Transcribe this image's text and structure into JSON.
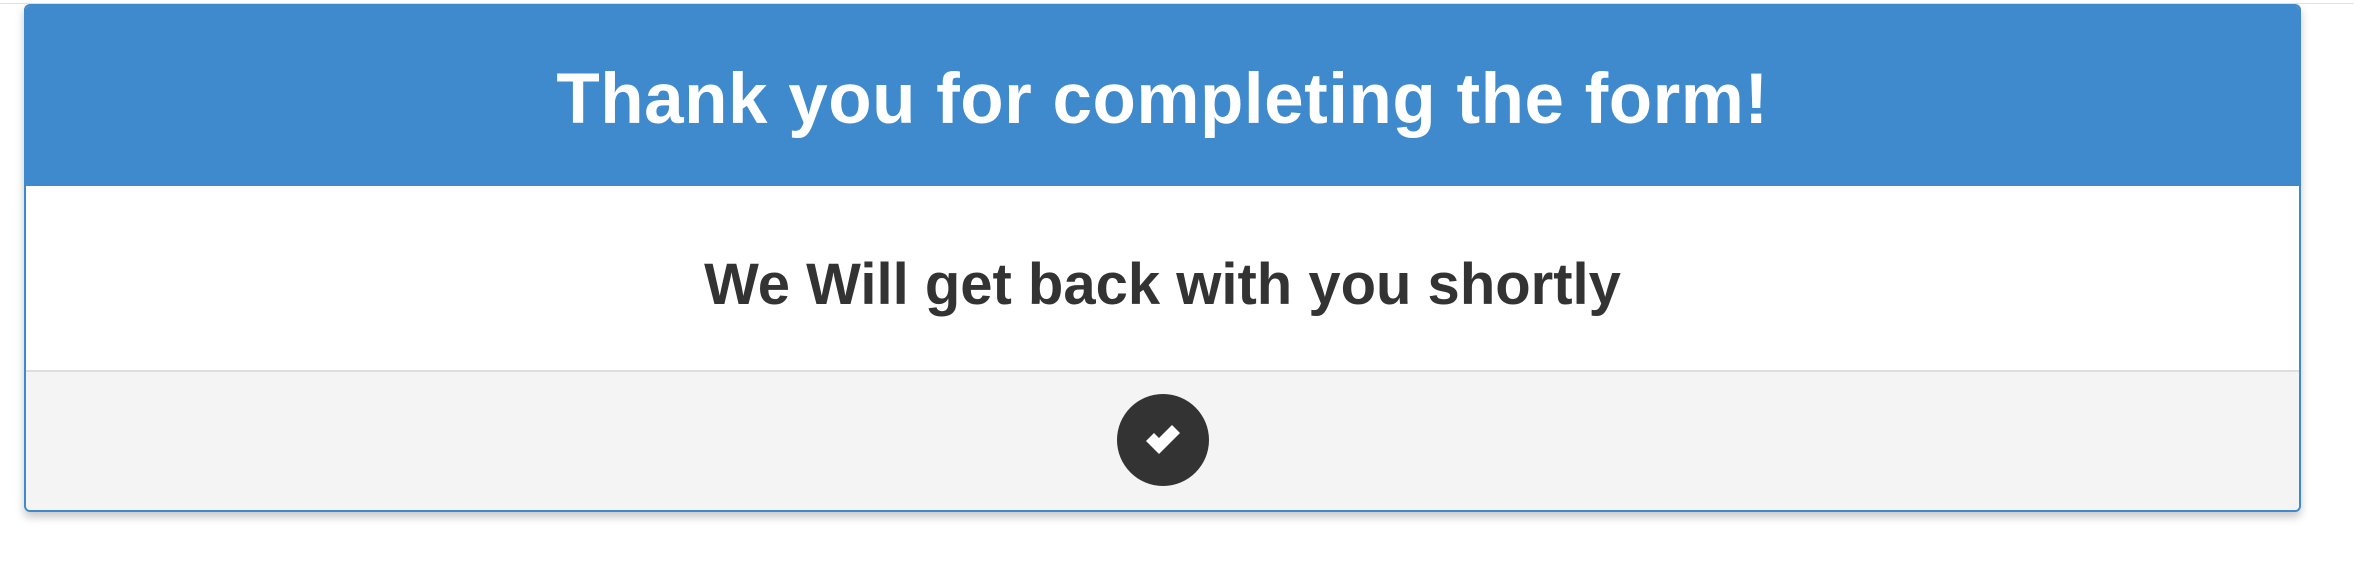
{
  "panel": {
    "title": "Thank you for completing the form!",
    "message": "We Will get back with you shortly",
    "footer_icon": "check-circle-icon"
  },
  "colors": {
    "header_background": "#3e8acc",
    "header_text": "#ffffff",
    "message_text": "#333333",
    "footer_background": "#f4f4f4",
    "icon_background": "#333333"
  }
}
